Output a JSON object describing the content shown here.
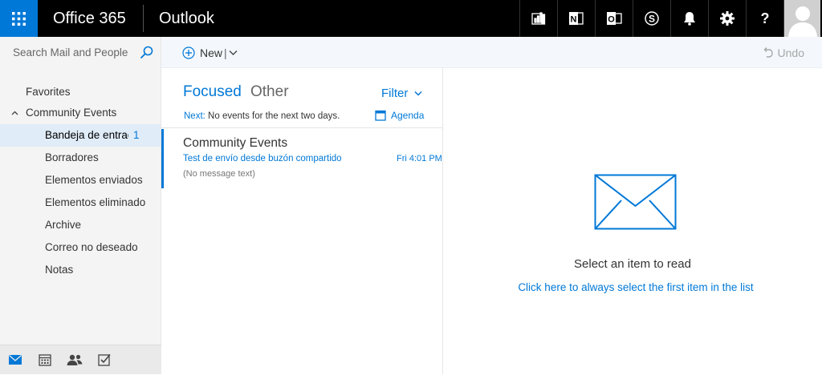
{
  "header": {
    "brand": "Office 365",
    "app": "Outlook",
    "icons": [
      "apps-icon",
      "power-bi-icon",
      "onenote-icon",
      "outlook-icon",
      "skype-icon",
      "bell-icon",
      "gear-icon",
      "help-icon",
      "avatar"
    ]
  },
  "search": {
    "placeholder": "Search Mail and People"
  },
  "toolbar": {
    "new_label": "New",
    "separator": "|",
    "undo_label": "Undo"
  },
  "folders": {
    "favorites": "Favorites",
    "group": "Community Events",
    "items": [
      {
        "label": "Bandeja de entrada",
        "count": "1",
        "selected": true
      },
      {
        "label": "Borradores"
      },
      {
        "label": "Elementos enviados"
      },
      {
        "label": "Elementos eliminado"
      },
      {
        "label": "Archive"
      },
      {
        "label": "Correo no deseado"
      },
      {
        "label": "Notas"
      }
    ]
  },
  "list": {
    "focused": "Focused",
    "other": "Other",
    "filter": "Filter",
    "next_label": "Next:",
    "next_text": "No events for the next two days.",
    "agenda": "Agenda",
    "messages": [
      {
        "sender": "Community Events",
        "subject": "Test de envío desde buzón compartido",
        "time": "Fri 4:01 PM",
        "preview": "(No message text)"
      }
    ]
  },
  "reading": {
    "message": "Select an item to read",
    "link": "Click here to always select the first item in the list"
  },
  "colors": {
    "accent": "#0078d7",
    "topbar": "#000000",
    "pane": "#f4f4f4",
    "selected": "#e0ecf7"
  }
}
